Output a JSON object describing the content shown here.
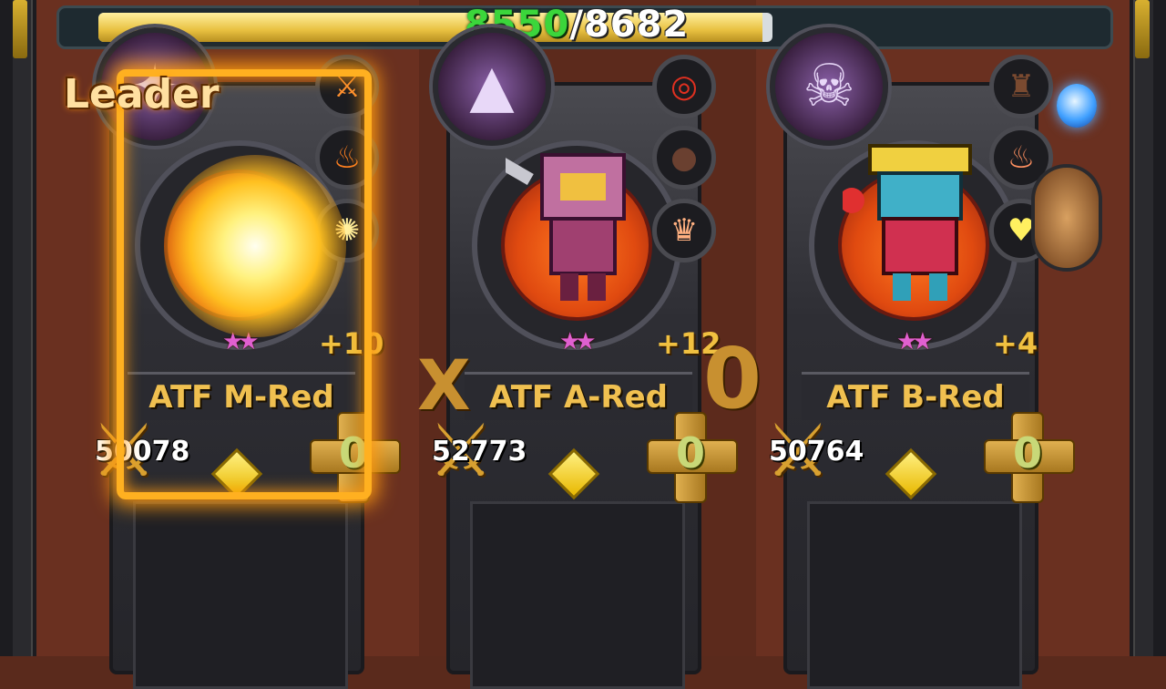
{
  "hp": {
    "current": "8550",
    "separator": "/",
    "max": "8682",
    "fill_fraction": 0.985
  },
  "leader_label": "Leader",
  "x_mark": "X",
  "o_mark": "0",
  "colors": {
    "hp_current": "#3bd63b",
    "name": "#f0c050",
    "leader_glow": "#ffb020",
    "stars": "#e060d0"
  },
  "team": [
    {
      "name": "ATF M-Red",
      "enhance": "+10",
      "stars": "★★",
      "power": "50078",
      "add_count": "0",
      "is_leader": true,
      "class_icon": "burst-icon",
      "skills": [
        "fire-slash-icon",
        "flame-claw-icon",
        "spark-icon"
      ]
    },
    {
      "name": "ATF A-Red",
      "enhance": "+12",
      "stars": "★★",
      "power": "52773",
      "add_count": "0",
      "is_leader": false,
      "class_icon": "wizard-hat-icon",
      "skills": [
        "target-icon",
        "shadow-icon",
        "crown-face-icon"
      ]
    },
    {
      "name": "ATF B-Red",
      "enhance": "+4",
      "stars": "★★",
      "power": "50764",
      "add_count": "0",
      "is_leader": false,
      "class_icon": "skull-icon",
      "skills": [
        "totem-icon",
        "potion-icon",
        "heart-icon"
      ]
    }
  ]
}
